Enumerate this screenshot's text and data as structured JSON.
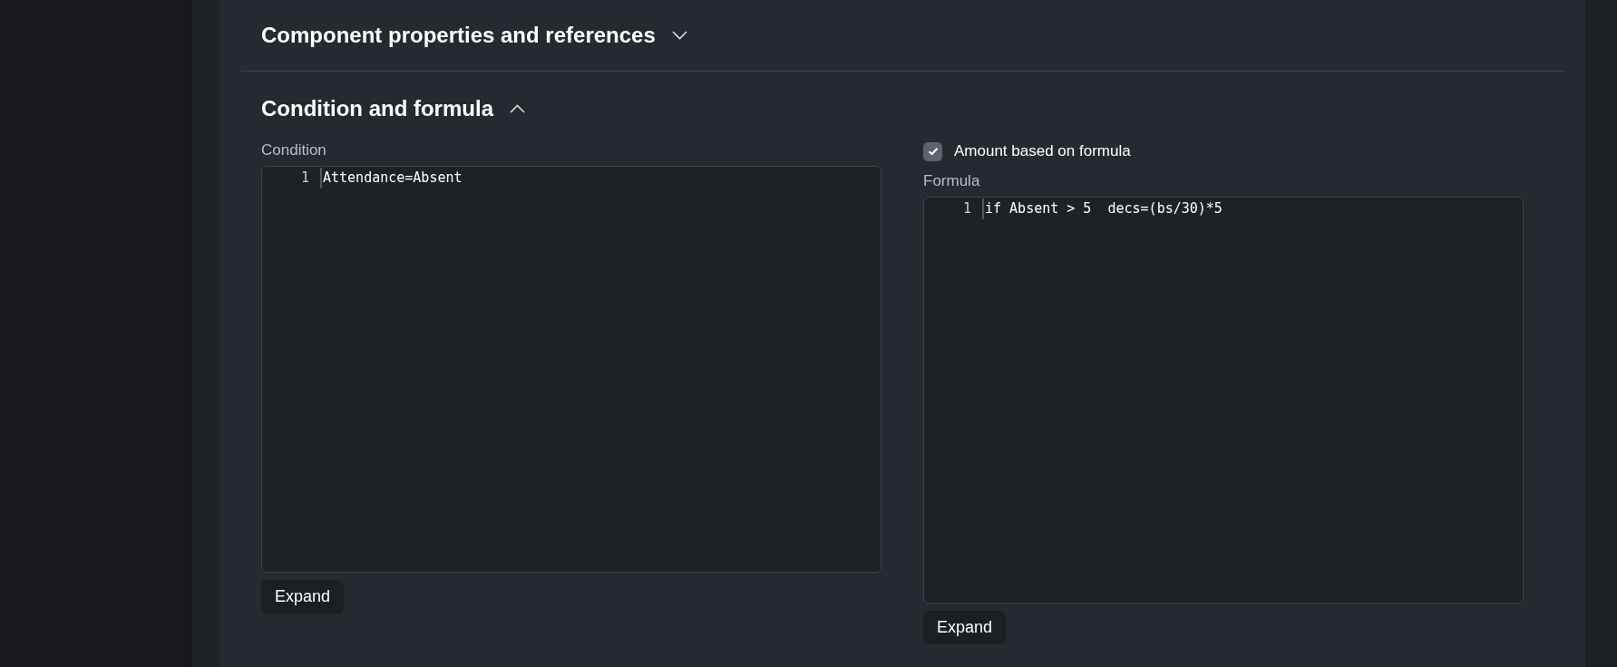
{
  "sections": [
    {
      "title": "Component properties and references",
      "expanded": false
    },
    {
      "title": "Condition and formula",
      "expanded": true
    }
  ],
  "condition": {
    "label": "Condition",
    "lines": [
      {
        "number": "1",
        "code": "Attendance=Absent"
      }
    ],
    "button": "Expand"
  },
  "formula_checkbox": {
    "label": "Amount based on formula",
    "checked": true
  },
  "formula": {
    "label": "Formula",
    "lines": [
      {
        "number": "1",
        "code": "if Absent > 5  decs=(bs/30)*5"
      }
    ],
    "button": "Expand"
  }
}
